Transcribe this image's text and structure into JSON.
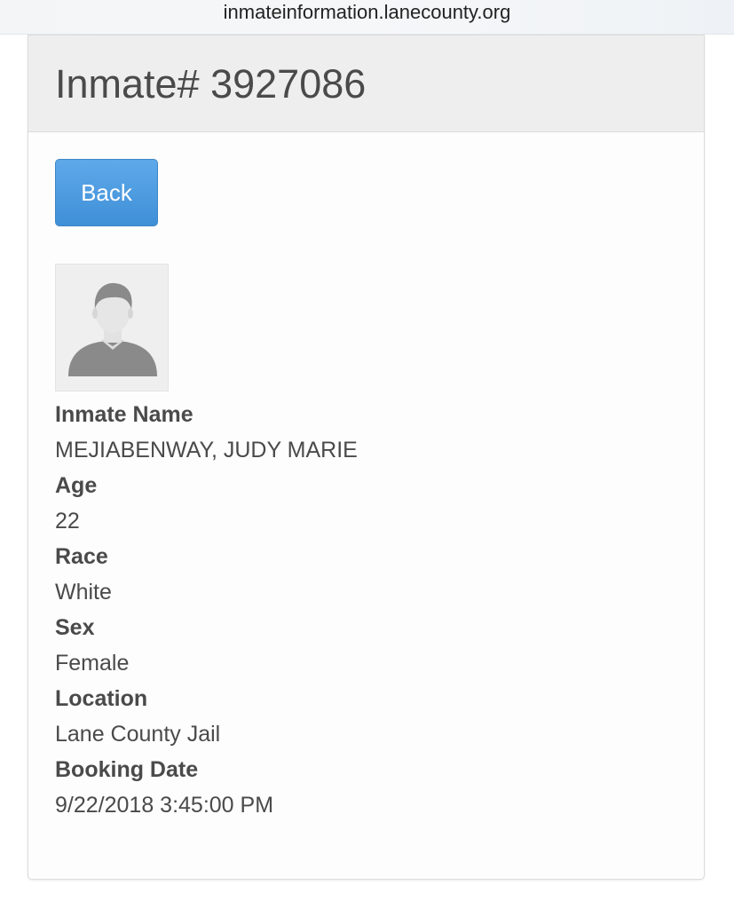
{
  "browser": {
    "url": "inmateinformation.lanecounty.org"
  },
  "header": {
    "title": "Inmate# 3927086"
  },
  "actions": {
    "back_label": "Back"
  },
  "photo": {
    "icon": "person-silhouette-icon"
  },
  "fields": [
    {
      "label": "Inmate Name",
      "value": "MEJIABENWAY, JUDY MARIE"
    },
    {
      "label": "Age",
      "value": "22"
    },
    {
      "label": "Race",
      "value": "White"
    },
    {
      "label": "Sex",
      "value": "Female"
    },
    {
      "label": "Location",
      "value": "Lane County Jail"
    },
    {
      "label": "Booking Date",
      "value": "9/22/2018 3:45:00 PM"
    }
  ],
  "colors": {
    "primary_button": "#428bca",
    "panel_heading_bg": "#eeeeee",
    "text": "#4a4a4a"
  }
}
